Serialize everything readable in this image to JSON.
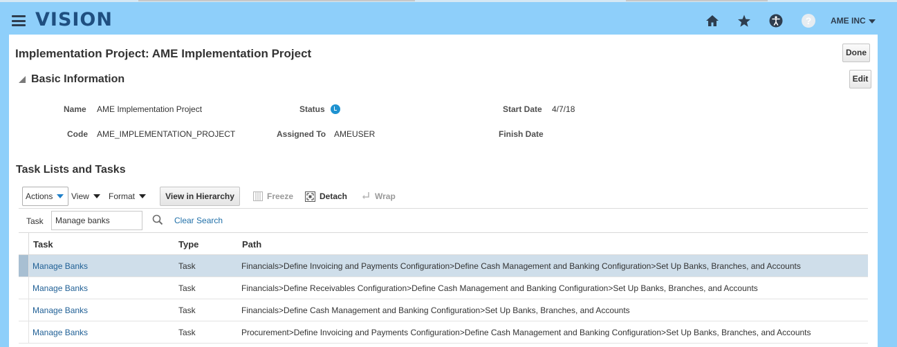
{
  "header": {
    "logo": "VISION",
    "user_menu": "AME INC",
    "icons": [
      "home-icon",
      "star-icon",
      "accessibility-icon",
      "help-icon"
    ],
    "help_glyph": "?"
  },
  "page": {
    "title": "Implementation Project: AME Implementation Project",
    "done_label": "Done",
    "edit_label": "Edit"
  },
  "basic_info": {
    "section_title": "Basic Information",
    "name_label": "Name",
    "name_value": "AME Implementation Project",
    "code_label": "Code",
    "code_value": "AME_IMPLEMENTATION_PROJECT",
    "status_label": "Status",
    "assigned_label": "Assigned To",
    "assigned_value": "AMEUSER",
    "start_label": "Start Date",
    "start_value": "4/7/18",
    "finish_label": "Finish Date",
    "finish_value": ""
  },
  "tasks": {
    "section_title": "Task Lists and Tasks",
    "toolbar": {
      "actions": "Actions",
      "view": "View",
      "format": "Format",
      "view_in_hierarchy": "View in Hierarchy",
      "freeze": "Freeze",
      "detach": "Detach",
      "wrap": "Wrap"
    },
    "filter": {
      "label": "Task",
      "value": "Manage banks",
      "clear_search": "Clear Search"
    },
    "columns": [
      "Task",
      "Type",
      "Path"
    ],
    "rows": [
      {
        "task": "Manage Banks",
        "type": "Task",
        "path": "Financials>Define Invoicing and Payments Configuration>Define Cash Management and Banking Configuration>Set Up Banks, Branches, and Accounts"
      },
      {
        "task": "Manage Banks",
        "type": "Task",
        "path": "Financials>Define Receivables Configuration>Define Cash Management and Banking Configuration>Set Up Banks, Branches, and Accounts"
      },
      {
        "task": "Manage Banks",
        "type": "Task",
        "path": "Financials>Define Cash Management and Banking Configuration>Set Up Banks, Branches, and Accounts"
      },
      {
        "task": "Manage Banks",
        "type": "Task",
        "path": "Procurement>Define Invoicing and Payments Configuration>Define Cash Management and Banking Configuration>Set Up Banks, Branches, and Accounts"
      }
    ]
  },
  "colors": {
    "background": "#8ecffa",
    "logo": "#1f4f80",
    "link": "#1f5f95",
    "selected_row": "#cfdeea",
    "status_icon": "#1e92d0"
  }
}
